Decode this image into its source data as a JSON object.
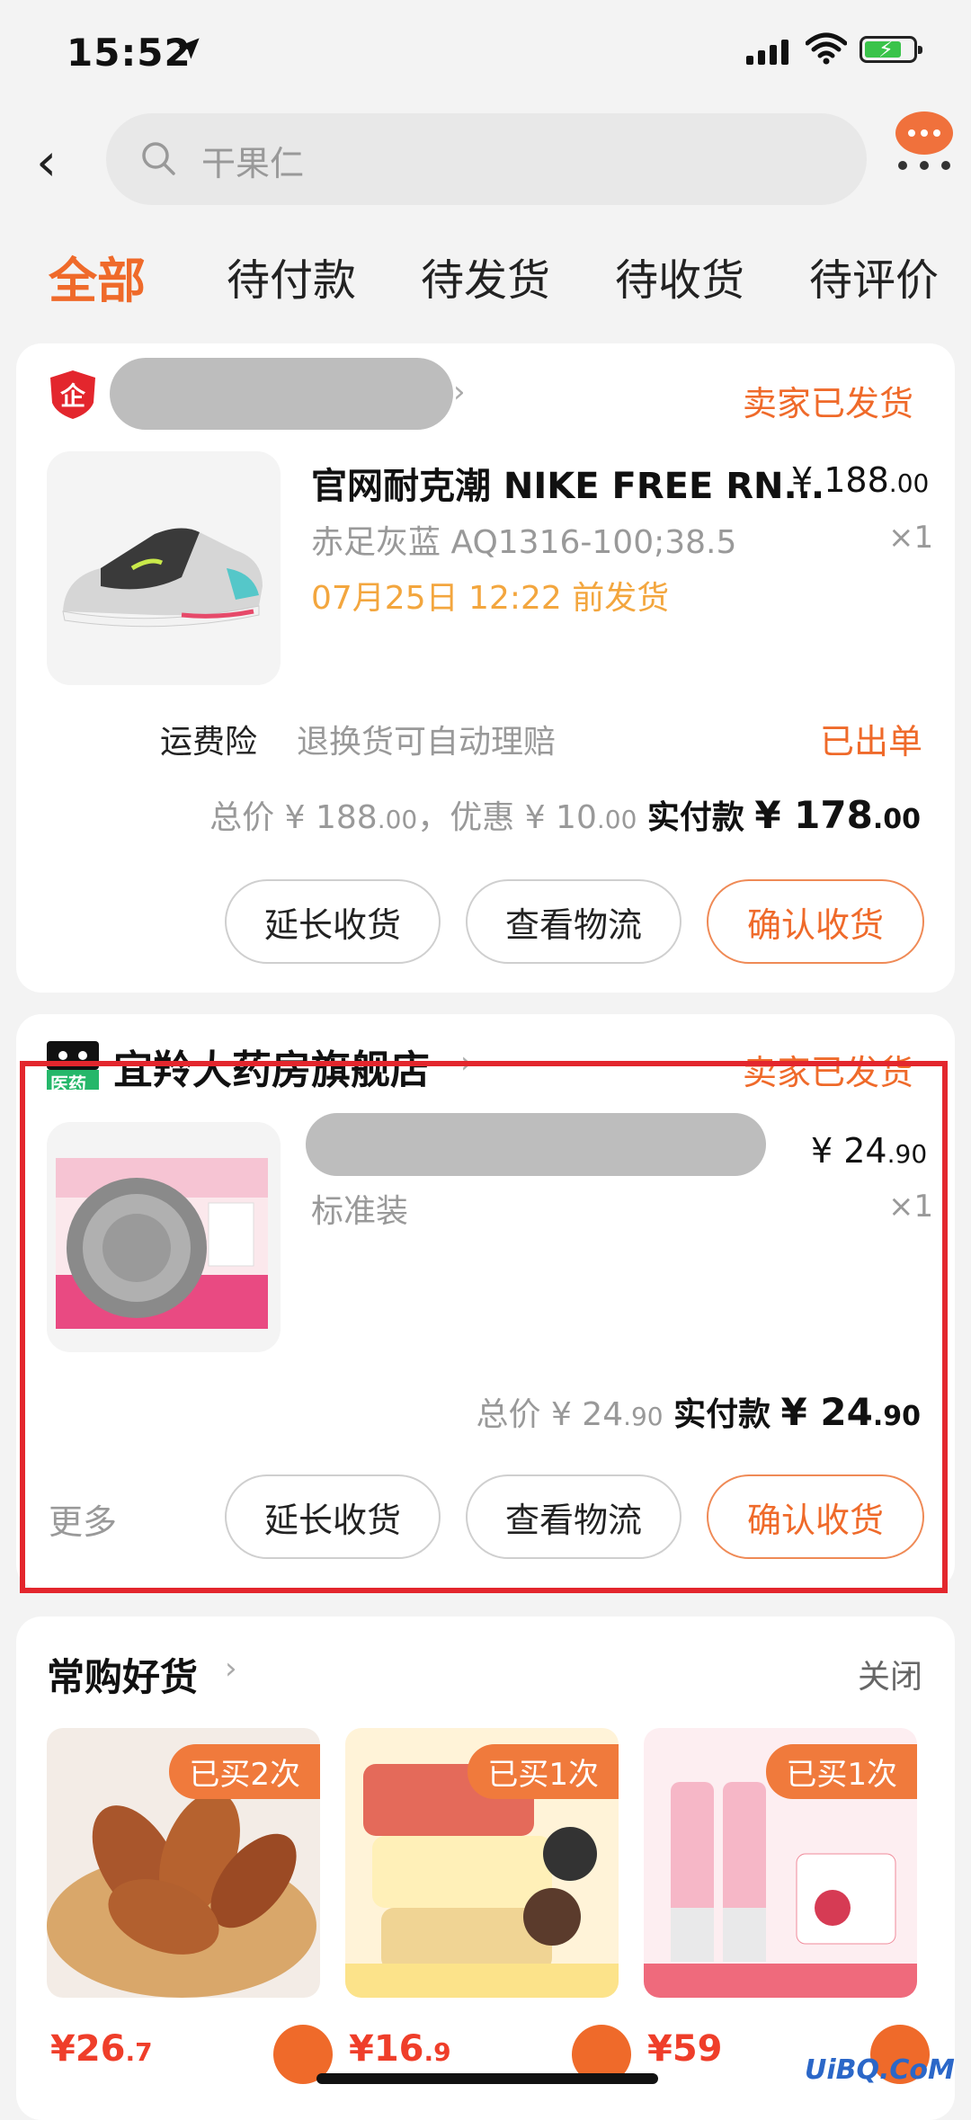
{
  "status_bar": {
    "time": "15:52"
  },
  "search": {
    "placeholder": "干果仁"
  },
  "tabs": [
    "全部",
    "待付款",
    "待发货",
    "待收货",
    "待评价"
  ],
  "orders": [
    {
      "status": "卖家已发货",
      "title": "官网耐克潮 NIKE FREE RN...",
      "price_int": "¥ 188",
      "price_dec": ".00",
      "sku": "赤足灰蓝 AQ1316-100;38.5",
      "qty": "×1",
      "ship_by": "07月25日 12:22 前发货",
      "insurance_label": "运费险",
      "insurance_desc": "退换货可自动理赔",
      "insurance_status": "已出单",
      "total_label": "总价",
      "total_int": "¥ 188",
      "total_dec": ".00",
      "discount_label": "，优惠",
      "discount_int": "¥ 10",
      "discount_dec": ".00",
      "paid_label": "实付款",
      "paid_int": "¥ 178",
      "paid_dec": ".00",
      "buttons": [
        "延长收货",
        "查看物流",
        "确认收货"
      ]
    },
    {
      "shop": "宜羚大药房旗舰店",
      "shop_tag": "医药",
      "status": "卖家已发货",
      "price_int": "¥ 24",
      "price_dec": ".90",
      "sku": "标准装",
      "qty": "×1",
      "total_label": "总价",
      "total_int": "¥ 24",
      "total_dec": ".90",
      "paid_label": "实付款",
      "paid_int": "¥ 24",
      "paid_dec": ".90",
      "more": "更多",
      "buttons": [
        "延长收货",
        "查看物流",
        "确认收货"
      ]
    }
  ],
  "recommend": {
    "title": "常购好货",
    "close": "关闭",
    "items": [
      {
        "badge": "已买2次",
        "price_int": "¥26",
        "price_dec": ".7"
      },
      {
        "badge": "已买1次",
        "price_int": "¥16",
        "price_dec": ".9"
      },
      {
        "badge": "已买1次",
        "price_int": "¥59",
        "price_dec": ""
      }
    ]
  },
  "watermark": "UiBQ.CoM",
  "colors": {
    "accent": "#ef6a2a",
    "ship_orange": "#f3a63e",
    "highlight_red": "#e3262d"
  }
}
